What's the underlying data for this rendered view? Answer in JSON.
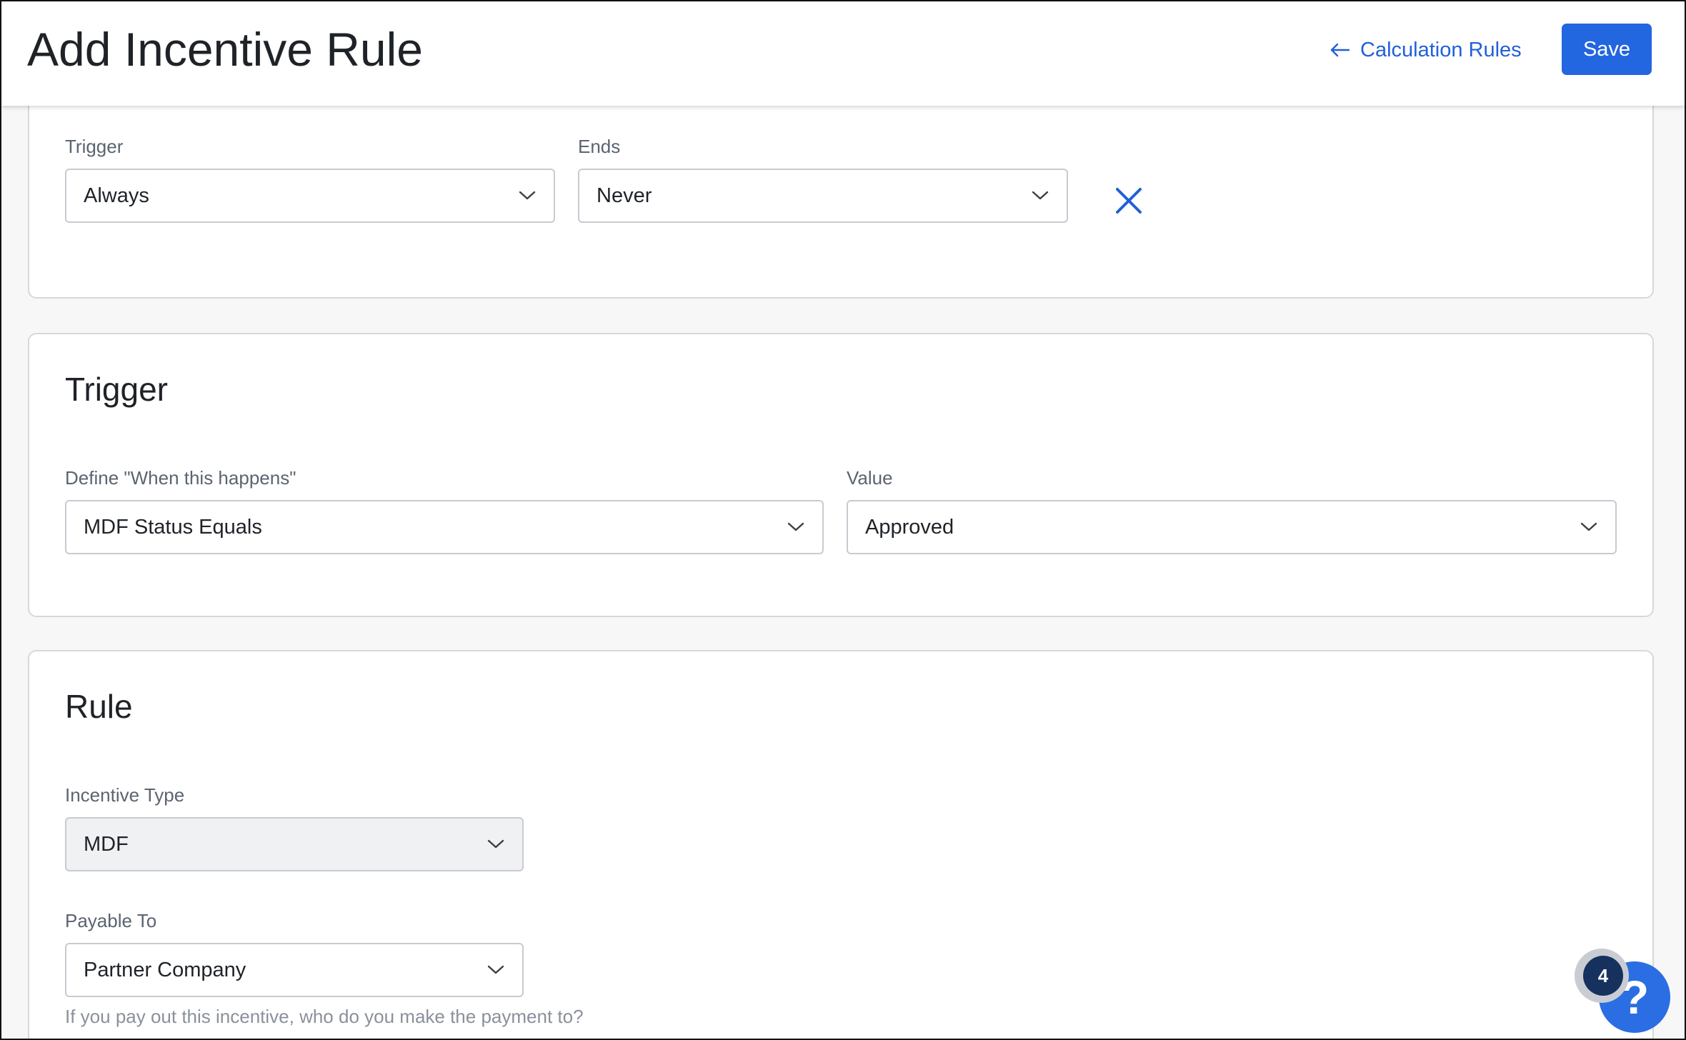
{
  "header": {
    "title": "Add Incentive Rule",
    "back_link_label": "Calculation Rules",
    "save_label": "Save"
  },
  "schedule": {
    "trigger_label": "Trigger",
    "trigger_value": "Always",
    "ends_label": "Ends",
    "ends_value": "Never"
  },
  "trigger_section": {
    "title": "Trigger",
    "define_label": "Define \"When this happens\"",
    "define_value": "MDF Status Equals",
    "value_label": "Value",
    "value_value": "Approved"
  },
  "rule_section": {
    "title": "Rule",
    "incentive_type_label": "Incentive Type",
    "incentive_type_value": "MDF",
    "payable_to_label": "Payable To",
    "payable_to_value": "Partner Company",
    "payable_to_helper": "If you pay out this incentive, who do you make the payment to?"
  },
  "help": {
    "badge_count": "4",
    "icon": "?"
  },
  "colors": {
    "accent": "#2266e0",
    "link": "#2160d8",
    "badge": "#16315e"
  },
  "icons": [
    "arrow-left-icon",
    "chevron-down-icon",
    "close-icon",
    "question-mark-icon"
  ]
}
